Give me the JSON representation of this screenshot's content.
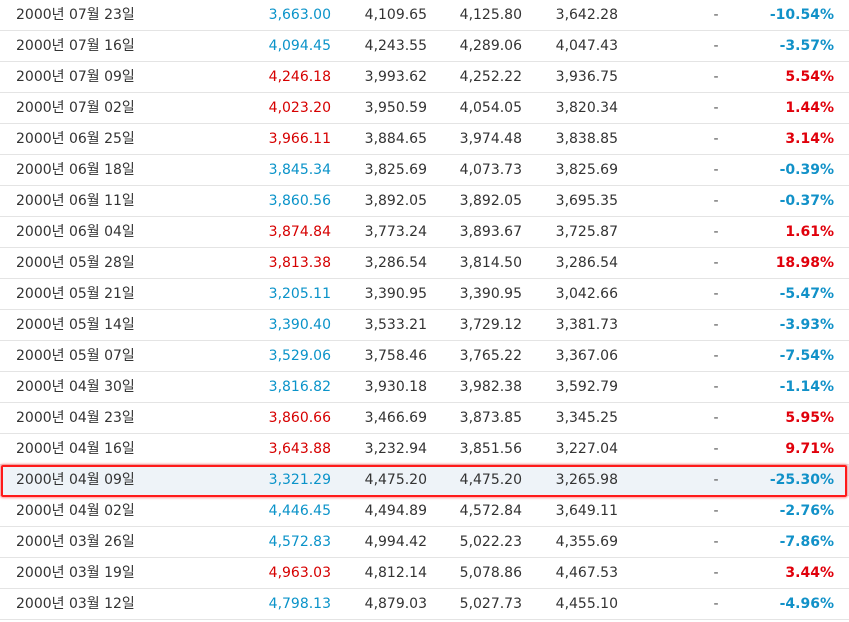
{
  "colors": {
    "up": "#d60000",
    "down": "#0a93c9",
    "highlight_border": "#ff1a1a"
  },
  "highlighted_row": 15,
  "rows": [
    {
      "date": "2000년 07월 23일",
      "close": "3,663.00",
      "open": "4,109.65",
      "high": "4,125.80",
      "low": "3,642.28",
      "volume": "-",
      "change": "-10.54%",
      "dir": "down"
    },
    {
      "date": "2000년 07월 16일",
      "close": "4,094.45",
      "open": "4,243.55",
      "high": "4,289.06",
      "low": "4,047.43",
      "volume": "-",
      "change": "-3.57%",
      "dir": "down"
    },
    {
      "date": "2000년 07월 09일",
      "close": "4,246.18",
      "open": "3,993.62",
      "high": "4,252.22",
      "low": "3,936.75",
      "volume": "-",
      "change": "5.54%",
      "dir": "up"
    },
    {
      "date": "2000년 07월 02일",
      "close": "4,023.20",
      "open": "3,950.59",
      "high": "4,054.05",
      "low": "3,820.34",
      "volume": "-",
      "change": "1.44%",
      "dir": "up"
    },
    {
      "date": "2000년 06월 25일",
      "close": "3,966.11",
      "open": "3,884.65",
      "high": "3,974.48",
      "low": "3,838.85",
      "volume": "-",
      "change": "3.14%",
      "dir": "up"
    },
    {
      "date": "2000년 06월 18일",
      "close": "3,845.34",
      "open": "3,825.69",
      "high": "4,073.73",
      "low": "3,825.69",
      "volume": "-",
      "change": "-0.39%",
      "dir": "down"
    },
    {
      "date": "2000년 06월 11일",
      "close": "3,860.56",
      "open": "3,892.05",
      "high": "3,892.05",
      "low": "3,695.35",
      "volume": "-",
      "change": "-0.37%",
      "dir": "down"
    },
    {
      "date": "2000년 06월 04일",
      "close": "3,874.84",
      "open": "3,773.24",
      "high": "3,893.67",
      "low": "3,725.87",
      "volume": "-",
      "change": "1.61%",
      "dir": "up"
    },
    {
      "date": "2000년 05월 28일",
      "close": "3,813.38",
      "open": "3,286.54",
      "high": "3,814.50",
      "low": "3,286.54",
      "volume": "-",
      "change": "18.98%",
      "dir": "up"
    },
    {
      "date": "2000년 05월 21일",
      "close": "3,205.11",
      "open": "3,390.95",
      "high": "3,390.95",
      "low": "3,042.66",
      "volume": "-",
      "change": "-5.47%",
      "dir": "down"
    },
    {
      "date": "2000년 05월 14일",
      "close": "3,390.40",
      "open": "3,533.21",
      "high": "3,729.12",
      "low": "3,381.73",
      "volume": "-",
      "change": "-3.93%",
      "dir": "down"
    },
    {
      "date": "2000년 05월 07일",
      "close": "3,529.06",
      "open": "3,758.46",
      "high": "3,765.22",
      "low": "3,367.06",
      "volume": "-",
      "change": "-7.54%",
      "dir": "down"
    },
    {
      "date": "2000년 04월 30일",
      "close": "3,816.82",
      "open": "3,930.18",
      "high": "3,982.38",
      "low": "3,592.79",
      "volume": "-",
      "change": "-1.14%",
      "dir": "down"
    },
    {
      "date": "2000년 04월 23일",
      "close": "3,860.66",
      "open": "3,466.69",
      "high": "3,873.85",
      "low": "3,345.25",
      "volume": "-",
      "change": "5.95%",
      "dir": "up"
    },
    {
      "date": "2000년 04월 16일",
      "close": "3,643.88",
      "open": "3,232.94",
      "high": "3,851.56",
      "low": "3,227.04",
      "volume": "-",
      "change": "9.71%",
      "dir": "up"
    },
    {
      "date": "2000년 04월 09일",
      "close": "3,321.29",
      "open": "4,475.20",
      "high": "4,475.20",
      "low": "3,265.98",
      "volume": "-",
      "change": "-25.30%",
      "dir": "down"
    },
    {
      "date": "2000년 04월 02일",
      "close": "4,446.45",
      "open": "4,494.89",
      "high": "4,572.84",
      "low": "3,649.11",
      "volume": "-",
      "change": "-2.76%",
      "dir": "down"
    },
    {
      "date": "2000년 03월 26일",
      "close": "4,572.83",
      "open": "4,994.42",
      "high": "5,022.23",
      "low": "4,355.69",
      "volume": "-",
      "change": "-7.86%",
      "dir": "down"
    },
    {
      "date": "2000년 03월 19일",
      "close": "4,963.03",
      "open": "4,812.14",
      "high": "5,078.86",
      "low": "4,467.53",
      "volume": "-",
      "change": "3.44%",
      "dir": "up"
    },
    {
      "date": "2000년 03월 12일",
      "close": "4,798.13",
      "open": "4,879.03",
      "high": "5,027.73",
      "low": "4,455.10",
      "volume": "-",
      "change": "-4.96%",
      "dir": "down"
    }
  ]
}
